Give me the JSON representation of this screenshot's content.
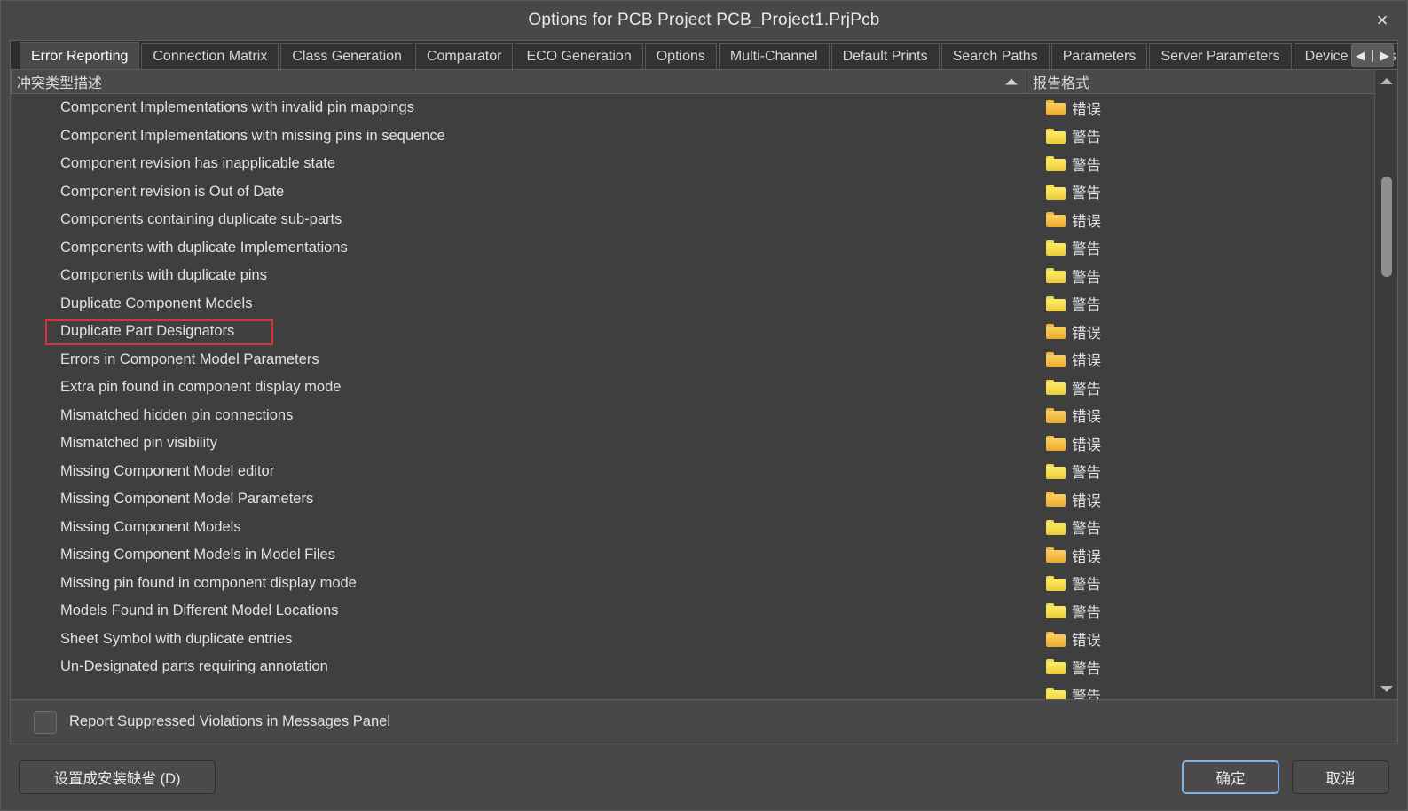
{
  "window": {
    "title": "Options for PCB Project PCB_Project1.PrjPcb",
    "close_icon": "close-icon",
    "close_glyph": "×"
  },
  "tabs": {
    "items": [
      {
        "label": "Error Reporting",
        "active": true
      },
      {
        "label": "Connection Matrix",
        "active": false
      },
      {
        "label": "Class Generation",
        "active": false
      },
      {
        "label": "Comparator",
        "active": false
      },
      {
        "label": "ECO Generation",
        "active": false
      },
      {
        "label": "Options",
        "active": false
      },
      {
        "label": "Multi-Channel",
        "active": false
      },
      {
        "label": "Default Prints",
        "active": false
      },
      {
        "label": "Search Paths",
        "active": false
      },
      {
        "label": "Parameters",
        "active": false
      },
      {
        "label": "Server Parameters",
        "active": false
      },
      {
        "label": "Device Sheets",
        "active": false
      }
    ],
    "scroll_left_glyph": "◀",
    "scroll_right_glyph": "▶"
  },
  "grid": {
    "columns": [
      {
        "key": "description",
        "label": "冲突类型描述",
        "sorted": true,
        "sort_dir": "asc"
      },
      {
        "key": "format",
        "label": "报告格式",
        "sorted": false
      }
    ],
    "level_error": "错误",
    "level_warning": "警告",
    "rows": [
      {
        "description": "Component Implementations with invalid pin mappings",
        "format": "错误",
        "level": "err"
      },
      {
        "description": "Component Implementations with missing pins in sequence",
        "format": "警告",
        "level": "warn"
      },
      {
        "description": "Component revision has inapplicable state",
        "format": "警告",
        "level": "warn"
      },
      {
        "description": "Component revision is Out of Date",
        "format": "警告",
        "level": "warn"
      },
      {
        "description": "Components containing duplicate sub-parts",
        "format": "错误",
        "level": "err"
      },
      {
        "description": "Components with duplicate Implementations",
        "format": "警告",
        "level": "warn"
      },
      {
        "description": "Components with duplicate pins",
        "format": "警告",
        "level": "warn"
      },
      {
        "description": "Duplicate Component Models",
        "format": "警告",
        "level": "warn"
      },
      {
        "description": "Duplicate Part Designators",
        "format": "错误",
        "level": "err",
        "highlighted": true
      },
      {
        "description": "Errors in Component Model Parameters",
        "format": "错误",
        "level": "err"
      },
      {
        "description": "Extra pin found in component display mode",
        "format": "警告",
        "level": "warn"
      },
      {
        "description": "Mismatched hidden pin connections",
        "format": "错误",
        "level": "err"
      },
      {
        "description": "Mismatched pin visibility",
        "format": "错误",
        "level": "err"
      },
      {
        "description": "Missing Component Model editor",
        "format": "警告",
        "level": "warn"
      },
      {
        "description": "Missing Component Model Parameters",
        "format": "错误",
        "level": "err"
      },
      {
        "description": "Missing Component Models",
        "format": "警告",
        "level": "warn"
      },
      {
        "description": "Missing Component Models in Model Files",
        "format": "错误",
        "level": "err"
      },
      {
        "description": "Missing pin found in component display mode",
        "format": "警告",
        "level": "warn"
      },
      {
        "description": "Models Found in Different Model Locations",
        "format": "警告",
        "level": "warn"
      },
      {
        "description": "Sheet Symbol with duplicate entries",
        "format": "错误",
        "level": "err"
      },
      {
        "description": "Un-Designated parts requiring annotation",
        "format": "警告",
        "level": "warn"
      },
      {
        "description": "",
        "format": "警告",
        "level": "warn"
      }
    ]
  },
  "options": {
    "report_suppressed_label": "Report Suppressed Violations in Messages Panel",
    "report_suppressed_checked": false
  },
  "footer": {
    "set_default_label": "设置成安装缺省 (D)",
    "ok_label": "确定",
    "cancel_label": "取消"
  },
  "colors": {
    "dialog_bg": "#484848",
    "list_bg": "#3f3f3f",
    "tab_active_bg": "#4a4a4a",
    "tab_inactive_bg": "#333333",
    "text": "#e2e2e2",
    "error_folder": "#f5bc42",
    "warning_folder": "#f5dc4a",
    "highlight_border": "#e03030",
    "focus_border": "#7fb2e6"
  }
}
